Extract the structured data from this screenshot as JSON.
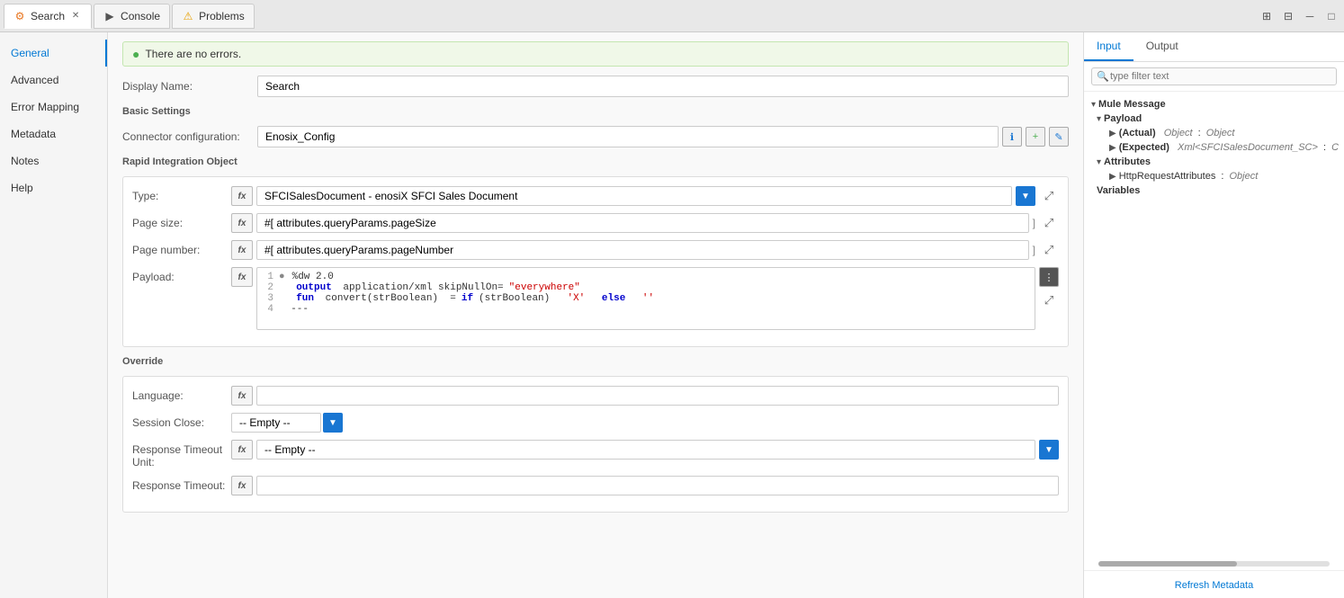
{
  "tabs": [
    {
      "id": "search",
      "label": "Search",
      "icon": "⚙",
      "active": true,
      "closable": true
    },
    {
      "id": "console",
      "label": "Console",
      "icon": "▶",
      "active": false
    },
    {
      "id": "problems",
      "label": "Problems",
      "icon": "⚠",
      "active": false
    }
  ],
  "topRightIcons": [
    "grid-icon",
    "layout-icon",
    "minimize-icon",
    "maximize-icon"
  ],
  "sidebar": {
    "items": [
      {
        "id": "general",
        "label": "General",
        "active": true
      },
      {
        "id": "advanced",
        "label": "Advanced",
        "active": false
      },
      {
        "id": "error-mapping",
        "label": "Error Mapping",
        "active": false
      },
      {
        "id": "metadata",
        "label": "Metadata",
        "active": false
      },
      {
        "id": "notes",
        "label": "Notes",
        "active": false
      },
      {
        "id": "help",
        "label": "Help",
        "active": false
      }
    ]
  },
  "status": {
    "icon": "✓",
    "text": "There are no errors."
  },
  "form": {
    "display_name_label": "Display Name:",
    "display_name_value": "Search",
    "basic_settings_title": "Basic Settings",
    "connector_config_label": "Connector configuration:",
    "connector_config_value": "Enosix_Config"
  },
  "rio": {
    "title": "Rapid Integration Object",
    "type_label": "Type:",
    "type_value": "SFCISalesDocument - enosiX SFCI Sales Document",
    "page_size_label": "Page size:",
    "page_size_value": "#[ attributes.queryParams.pageSize",
    "page_number_label": "Page number:",
    "page_number_value": "#[ attributes.queryParams.pageNumber",
    "payload_label": "Payload:",
    "code_lines": [
      {
        "num": "1",
        "content": "%dw 2.0",
        "has_dot": true
      },
      {
        "num": "2",
        "content": "output application/xml skipNullOn=\"everywhere\""
      },
      {
        "num": "3",
        "content": "fun convert(strBoolean)  = if(strBoolean)  'X'  else ''"
      },
      {
        "num": "4",
        "content": "---"
      }
    ]
  },
  "override": {
    "title": "Override",
    "language_label": "Language:",
    "language_value": "",
    "session_close_label": "Session Close:",
    "session_close_value": "-- Empty --",
    "response_timeout_unit_label": "Response Timeout Unit:",
    "response_timeout_unit_value": "-- Empty --",
    "response_timeout_label": "Response Timeout:",
    "response_timeout_value": ""
  },
  "right_panel": {
    "tabs": [
      {
        "label": "Input",
        "active": true
      },
      {
        "label": "Output",
        "active": false
      }
    ],
    "search_placeholder": "type filter text",
    "tree": {
      "mule_message": "Mule Message",
      "payload": "Payload",
      "actual": "(Actual)",
      "actual_type": "Object",
      "actual_colon": ":",
      "actual_type2": "Object",
      "expected": "(Expected)",
      "expected_type": "Xml<SFCISalesDocument_SC>",
      "expected_colon": ":",
      "expected_rest": "C",
      "attributes": "Attributes",
      "http_request": "HttpRequestAttributes",
      "http_type": ":",
      "http_type2": "Object",
      "variables": "Variables"
    },
    "refresh_label": "Refresh Metadata"
  }
}
